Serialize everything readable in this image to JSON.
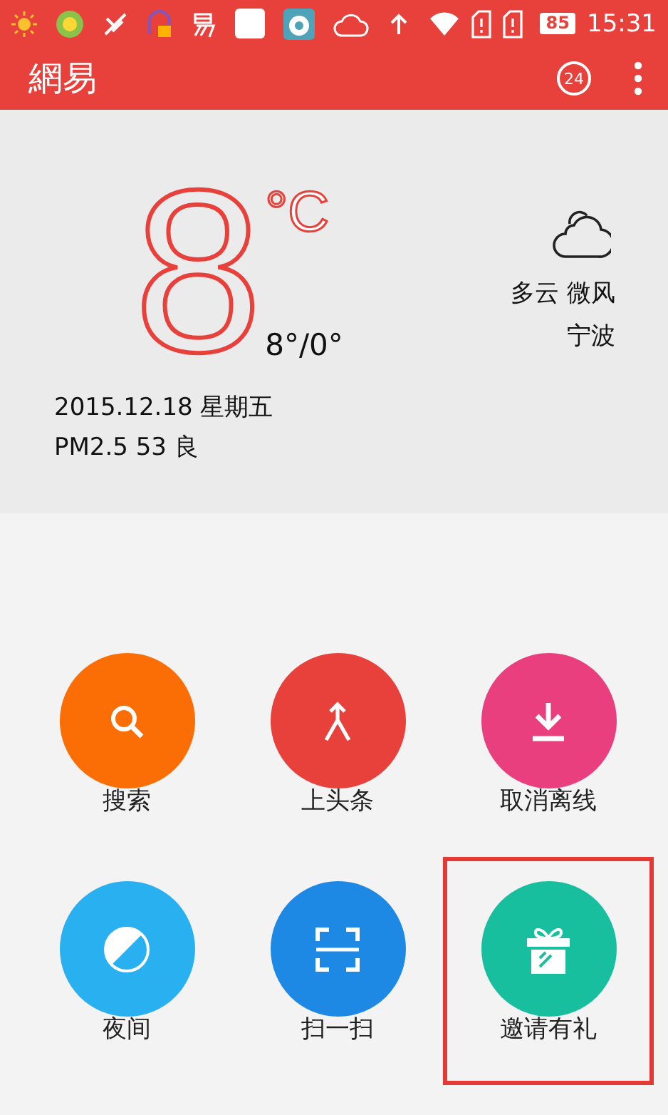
{
  "status_bar": {
    "battery": "85",
    "time": "15:31"
  },
  "header": {
    "logo": "網易",
    "badge": "24"
  },
  "weather": {
    "temperature": "8",
    "unit": "°C",
    "range": "8°/0°",
    "condition": "多云 微风",
    "city": "宁波",
    "date": "2015.12.18 星期五",
    "air_quality": "PM2.5 53 良"
  },
  "actions": [
    {
      "label": "搜索",
      "kind": "search",
      "color": "#fb6e06",
      "highlighted": false
    },
    {
      "label": "上头条",
      "kind": "merge",
      "color": "#e8413b",
      "highlighted": false
    },
    {
      "label": "取消离线",
      "kind": "download",
      "color": "#ea3f7f",
      "highlighted": false
    },
    {
      "label": "夜间",
      "kind": "night",
      "color": "#29b0f0",
      "highlighted": false
    },
    {
      "label": "扫一扫",
      "kind": "scan",
      "color": "#1e88e5",
      "highlighted": false
    },
    {
      "label": "邀请有礼",
      "kind": "gift",
      "color": "#17bf9f",
      "highlighted": true
    }
  ]
}
